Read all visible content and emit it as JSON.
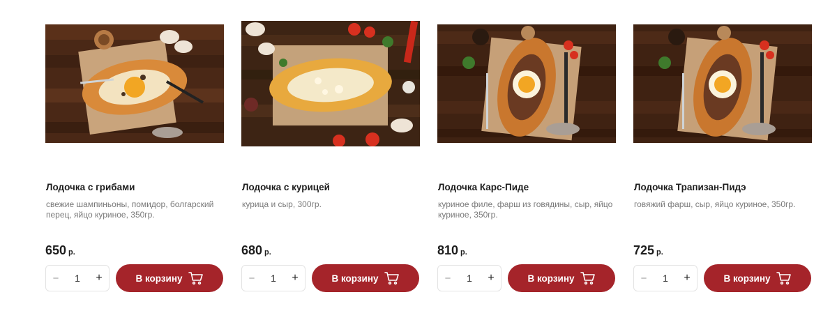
{
  "currency": "р.",
  "cart_label": "В корзину",
  "colors": {
    "accent": "#a5242a",
    "wood_dark": "#4a2816",
    "dough": "#d98a3a",
    "yolk": "#f2a623"
  },
  "products": [
    {
      "title": "Лодочка с грибами",
      "description": "свежие шампиньоны, помидор, болгарский перец, яйцо куриное, 350гр.",
      "price": "650",
      "quantity": "1",
      "image": "khachapuri-mushrooms-photo"
    },
    {
      "title": "Лодочка с курицей",
      "description": "курица и сыр, 300гр.",
      "price": "680",
      "quantity": "1",
      "image": "khachapuri-chicken-photo"
    },
    {
      "title": "Лодочка Карс-Пиде",
      "description": "куриное филе, фарш из говядины, сыр, яйцо куриное, 350гр.",
      "price": "810",
      "quantity": "1",
      "image": "khachapuri-kars-pide-photo"
    },
    {
      "title": "Лодочка Трапизан-Пидэ",
      "description": "говяжий фарш, сыр, яйцо куриное, 350гр.",
      "price": "725",
      "quantity": "1",
      "image": "khachapuri-trapizan-pide-photo"
    }
  ]
}
